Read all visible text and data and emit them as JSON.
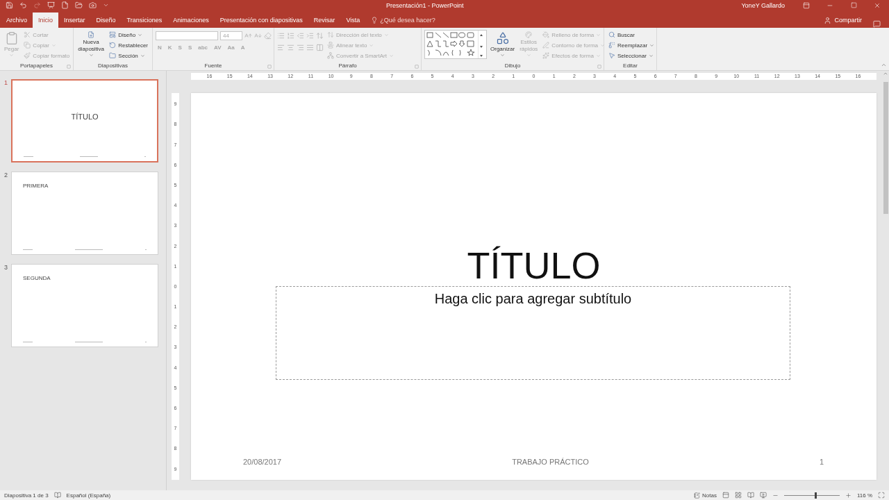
{
  "window": {
    "title": "Presentación1 - PowerPoint",
    "user": "YoneY Gallardo"
  },
  "tabs": [
    {
      "label": "Archivo",
      "selected": false
    },
    {
      "label": "Inicio",
      "selected": true
    },
    {
      "label": "Insertar",
      "selected": false
    },
    {
      "label": "Diseño",
      "selected": false
    },
    {
      "label": "Transiciones",
      "selected": false
    },
    {
      "label": "Animaciones",
      "selected": false
    },
    {
      "label": "Presentación con diapositivas",
      "selected": false
    },
    {
      "label": "Revisar",
      "selected": false
    },
    {
      "label": "Vista",
      "selected": false
    }
  ],
  "tell_me": {
    "placeholder": "¿Qué desea hacer?"
  },
  "share": "Compartir",
  "ribbon": {
    "groups": [
      {
        "label": "Portapapeles",
        "kind": "buttons",
        "items": [
          {
            "kind": "large",
            "label": "Pegar",
            "disabled": true,
            "menu": true
          },
          {
            "kind": "small",
            "label": "Cortar",
            "disabled": true,
            "menu": false
          },
          {
            "kind": "small",
            "label": "Copiar",
            "disabled": true,
            "menu": true
          },
          {
            "kind": "small",
            "label": "Copiar formato",
            "disabled": true,
            "menu": false
          }
        ]
      },
      {
        "label": "Diapositivas",
        "kind": "buttons",
        "items": [
          {
            "kind": "large",
            "label": "Nueva diapositiva",
            "disabled": false,
            "menu": true
          },
          {
            "kind": "small",
            "label": "Diseño",
            "disabled": false,
            "menu": true
          },
          {
            "kind": "small",
            "label": "Restablecer",
            "disabled": false,
            "menu": false
          },
          {
            "kind": "small",
            "label": "Sección",
            "disabled": false,
            "menu": true
          }
        ]
      },
      {
        "label": "Fuente",
        "kind": "font",
        "disabled": true,
        "size": "44",
        "format_buttons": [
          "N",
          "K",
          "S",
          "S",
          "abc",
          "AV",
          "Aa",
          "A"
        ]
      },
      {
        "label": "Párrafo",
        "kind": "paragraph",
        "items": [
          {
            "kind": "small",
            "label": "Dirección del texto",
            "disabled": true,
            "menu": true
          },
          {
            "kind": "small",
            "label": "Alinear texto",
            "disabled": true,
            "menu": true
          },
          {
            "kind": "small",
            "label": "Convertir a SmartArt",
            "disabled": true,
            "menu": true
          }
        ]
      },
      {
        "label": "Dibujo",
        "kind": "drawing",
        "items": [
          {
            "kind": "large",
            "label": "Organizar",
            "disabled": false,
            "menu": true
          },
          {
            "kind": "large",
            "label": "Estilos rápidos",
            "disabled": true,
            "menu": true
          },
          {
            "kind": "small",
            "label": "Relleno de forma",
            "disabled": true,
            "menu": true
          },
          {
            "kind": "small",
            "label": "Contorno de forma",
            "disabled": true,
            "menu": true
          },
          {
            "kind": "small",
            "label": "Efectos de forma",
            "disabled": true,
            "menu": true
          }
        ]
      },
      {
        "label": "Editar",
        "kind": "buttons",
        "items": [
          {
            "kind": "small",
            "label": "Buscar",
            "disabled": false,
            "menu": false
          },
          {
            "kind": "small",
            "label": "Reemplazar",
            "disabled": false,
            "menu": true
          },
          {
            "kind": "small",
            "label": "Seleccionar",
            "disabled": false,
            "menu": true
          }
        ]
      }
    ]
  },
  "ruler": {
    "horizontal": [
      "16",
      "15",
      "14",
      "13",
      "12",
      "11",
      "10",
      "9",
      "8",
      "7",
      "6",
      "5",
      "4",
      "3",
      "2",
      "1",
      "0",
      "1",
      "2",
      "3",
      "4",
      "5",
      "6",
      "7",
      "8",
      "9",
      "10",
      "11",
      "12",
      "13",
      "14",
      "15",
      "16"
    ],
    "vertical": [
      "9",
      "8",
      "7",
      "6",
      "5",
      "4",
      "3",
      "2",
      "1",
      "0",
      "1",
      "2",
      "3",
      "4",
      "5",
      "6",
      "7",
      "8",
      "9"
    ]
  },
  "slides": [
    {
      "number": "1",
      "title": "TÍTULO",
      "kind": "title",
      "selected": true
    },
    {
      "number": "2",
      "title": "PRIMERA",
      "kind": "content",
      "selected": false
    },
    {
      "number": "3",
      "title": "SEGUNDA",
      "kind": "content",
      "selected": false
    }
  ],
  "slide": {
    "title": "TÍTULO",
    "subtitle_placeholder": "Haga clic para agregar subtítulo",
    "date": "20/08/2017",
    "footer": "TRABAJO PRÁCTICO",
    "number": "1"
  },
  "status_bar": {
    "slide_info": "Diapositiva 1 de 3",
    "language": "Español (España)",
    "notes": "Notas",
    "zoom": "116 %",
    "zoom_slider": {
      "level": 0.55
    }
  }
}
